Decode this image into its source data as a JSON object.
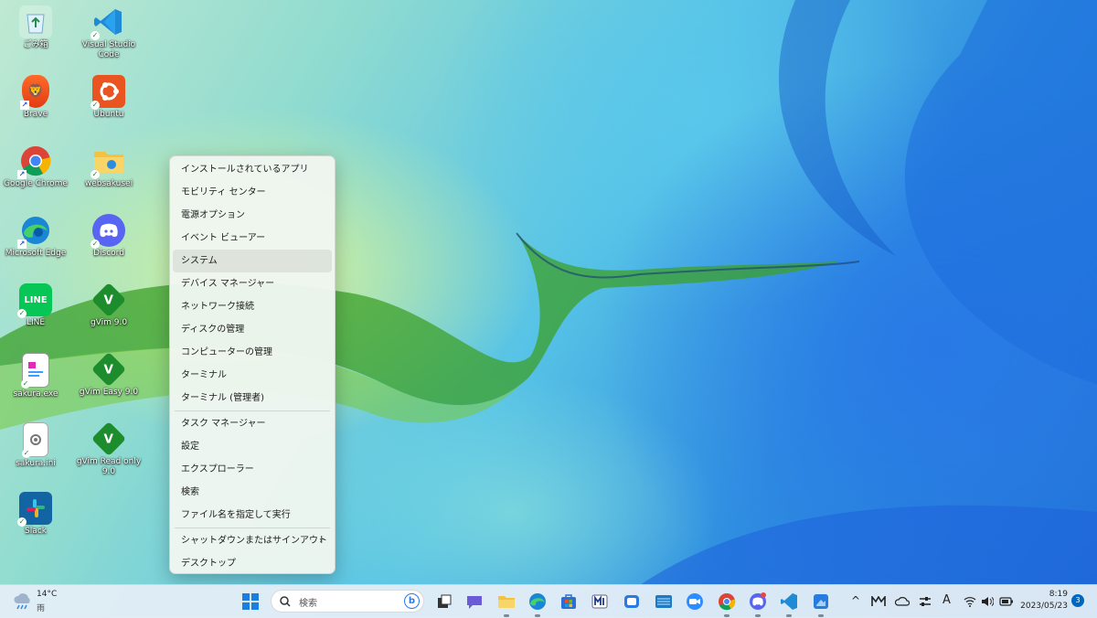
{
  "desktop": {
    "icons": [
      {
        "label": "ごみ箱",
        "icon": "recycle-bin-icon"
      },
      {
        "label": "Visual Studio Code",
        "icon": "vscode-icon"
      },
      {
        "label": "Brave",
        "icon": "brave-icon"
      },
      {
        "label": "Ubuntu",
        "icon": "ubuntu-icon"
      },
      {
        "label": "Google Chrome",
        "icon": "chrome-icon"
      },
      {
        "label": "websakusei",
        "icon": "folder-icon"
      },
      {
        "label": "Microsoft Edge",
        "icon": "edge-icon"
      },
      {
        "label": "Discord",
        "icon": "discord-icon"
      },
      {
        "label": "LINE",
        "icon": "line-icon"
      },
      {
        "label": "gVim 9.0",
        "icon": "vim-icon"
      },
      {
        "label": "sakura.exe",
        "icon": "sakura-icon"
      },
      {
        "label": "gVim Easy 9.0",
        "icon": "vim-icon"
      },
      {
        "label": "sakura.ini",
        "icon": "ini-file-icon"
      },
      {
        "label": "gVim Read only 9.0",
        "icon": "vim-icon"
      },
      {
        "label": "Slack",
        "icon": "slack-icon"
      }
    ]
  },
  "menu": {
    "items": [
      "インストールされているアプリ",
      "モビリティ センター",
      "電源オプション",
      "イベント ビューアー",
      "システム",
      "デバイス マネージャー",
      "ネットワーク接続",
      "ディスクの管理",
      "コンピューターの管理",
      "ターミナル",
      "ターミナル (管理者)",
      "タスク マネージャー",
      "設定",
      "エクスプローラー",
      "検索",
      "ファイル名を指定して実行",
      "シャットダウンまたはサインアウト",
      "デスクトップ"
    ],
    "highlighted": "システム",
    "submenu_arrow": "›"
  },
  "taskbar": {
    "weather": {
      "temp": "14°C",
      "condition": "雨",
      "icon": "weather-rain-icon"
    },
    "search_placeholder": "検索",
    "apps": [
      "start-icon",
      "task-view-icon",
      "chat-icon",
      "file-explorer-icon",
      "edge-icon",
      "store-icon",
      "mail-icon",
      "photos-icon",
      "zoom-icon",
      "chrome-icon",
      "discord-icon",
      "vscode-icon",
      "snipping-icon"
    ],
    "tray": {
      "chevron": "^",
      "ime": "A",
      "time": "8:19",
      "date": "2023/05/23",
      "notifications": "3"
    }
  },
  "colors": {
    "menu_bg": "#f0f6f0",
    "accent": "#0067c0",
    "taskbar_bg": "#e4eef6"
  }
}
